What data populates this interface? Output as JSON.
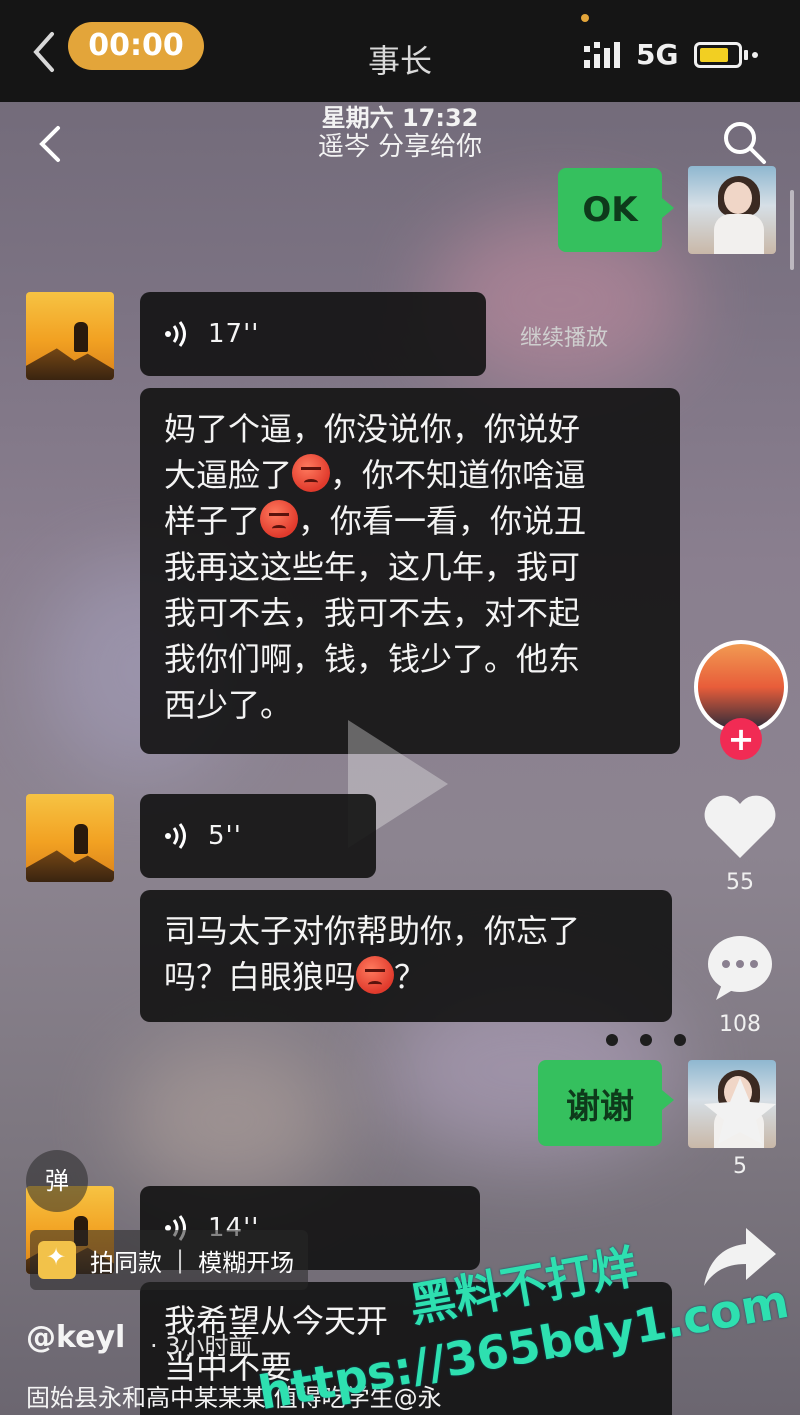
{
  "status_bar": {
    "time": "00:00",
    "title": "事长",
    "network": "5G"
  },
  "header": {
    "date": "星期六 17:32",
    "share_text": "遥岑 分享给你"
  },
  "messages": {
    "ok_label": "OK",
    "voice1_duration": "17''",
    "continue_playing": "继续播放",
    "text1_lines": [
      "妈了个逼，你没说你，你说好",
      "大逼脸了",
      "，你不知道你啥逼",
      "样子了",
      "，你看一看，你说丑",
      "我再这这些年，这几年，我可",
      "我可不去，我可不去，对不起",
      "我你们啊，钱，钱少了。他东",
      "西少了。"
    ],
    "voice2_duration": "5''",
    "text2_line1": "司马太子对你帮助你，你忘了",
    "text2_line2a": "吗？白眼狼吗",
    "text2_line2b": "？",
    "thanks_label": "谢谢",
    "voice3_duration": "14''",
    "text3_partial": "我希望从今天开",
    "text3_partial2": "当中不要"
  },
  "sidebar": {
    "likes": "55",
    "comments": "108",
    "favorites": "5"
  },
  "bottom": {
    "danmu": "弹",
    "tag1": "拍同款",
    "tag2": "模糊开场",
    "author": "@keyl",
    "author_suffix": "· 3小时前",
    "description": "固始县永和高中某某某 值得吃学生@永"
  },
  "watermark": {
    "line1": "黑料不打烊",
    "line2": "https://365bdy1.com"
  }
}
